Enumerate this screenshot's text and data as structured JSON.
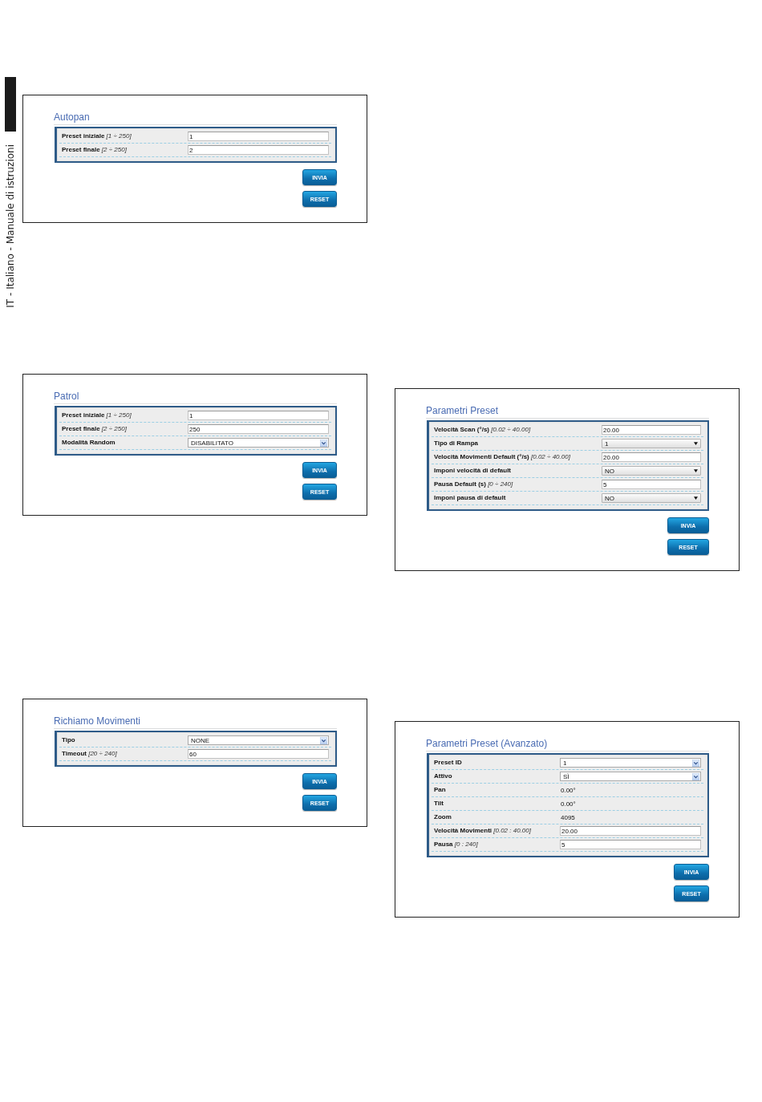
{
  "side_label": {
    "text": "IT - Italiano - Manuale di istruzioni"
  },
  "columns": [
    {
      "panels": [
        {
          "title": "Autopan",
          "rows": [
            {
              "kind": "input",
              "label": "Preset iniziale *[1 ÷ 250]*",
              "value": "1"
            },
            {
              "kind": "input",
              "label": "Preset finale *[2 ÷ 250]*",
              "value": "2"
            }
          ],
          "buttons": [
            "INVIA",
            "RESET"
          ]
        },
        {
          "title": "Patrol",
          "rows": [
            {
              "kind": "input",
              "label": "Preset iniziale *[1 ÷ 250]*",
              "value": "1"
            },
            {
              "kind": "input",
              "label": "Preset finale *[2 ÷ 250]*",
              "value": "250"
            },
            {
              "kind": "select",
              "label": "Modalità Random",
              "value": "DISABILITATO"
            }
          ],
          "buttons": [
            "INVIA",
            "RESET"
          ]
        },
        {
          "title": "Richiamo Movimenti",
          "rows": [
            {
              "kind": "select",
              "label": "Tipo",
              "value": "NONE"
            },
            {
              "kind": "input",
              "label": "Timeout *[20 ÷ 240]*",
              "value": "60"
            }
          ],
          "buttons": [
            "INVIA",
            "RESET"
          ]
        }
      ]
    },
    {
      "panels": [
        {
          "title": "Parametri Preset",
          "rows": [
            {
              "kind": "input",
              "label": "Velocità Scan (°/s) *[0.02 ÷ 40.00]*",
              "value": "20.00"
            },
            {
              "kind": "dropdown",
              "label": "Tipo di Rampa",
              "value": "1"
            },
            {
              "kind": "input",
              "label": "Velocità Movimenti Default (°/s) *[0.02 ÷ 40.00]*",
              "value": "20.00"
            },
            {
              "kind": "dropdown",
              "label": "Imponi velocità di default",
              "value": "NO"
            },
            {
              "kind": "input",
              "label": "Pausa Default (s) *[0 ÷ 240]*",
              "value": "5"
            },
            {
              "kind": "dropdown",
              "label": "Imponi pausa di default",
              "value": "NO"
            }
          ],
          "buttons": [
            "INVIA",
            "RESET"
          ]
        },
        {
          "title": "Parametri Preset (Avanzato)",
          "rows": [
            {
              "kind": "select",
              "label": "Preset ID",
              "value": "1"
            },
            {
              "kind": "select",
              "label": "Attivo",
              "value": "SÌ"
            },
            {
              "kind": "text",
              "label": "Pan",
              "value": "0.00°"
            },
            {
              "kind": "text",
              "label": "Tilt",
              "value": "0.00°"
            },
            {
              "kind": "text",
              "label": "Zoom",
              "value": "4095"
            },
            {
              "kind": "input",
              "label": "Velocità Movimenti *[0.02 : 40.00]*",
              "value": "20.00"
            },
            {
              "kind": "input",
              "label": "Pausa *[0 : 240]*",
              "value": "5"
            }
          ],
          "buttons": [
            "INVIA",
            "RESET"
          ]
        }
      ]
    }
  ]
}
